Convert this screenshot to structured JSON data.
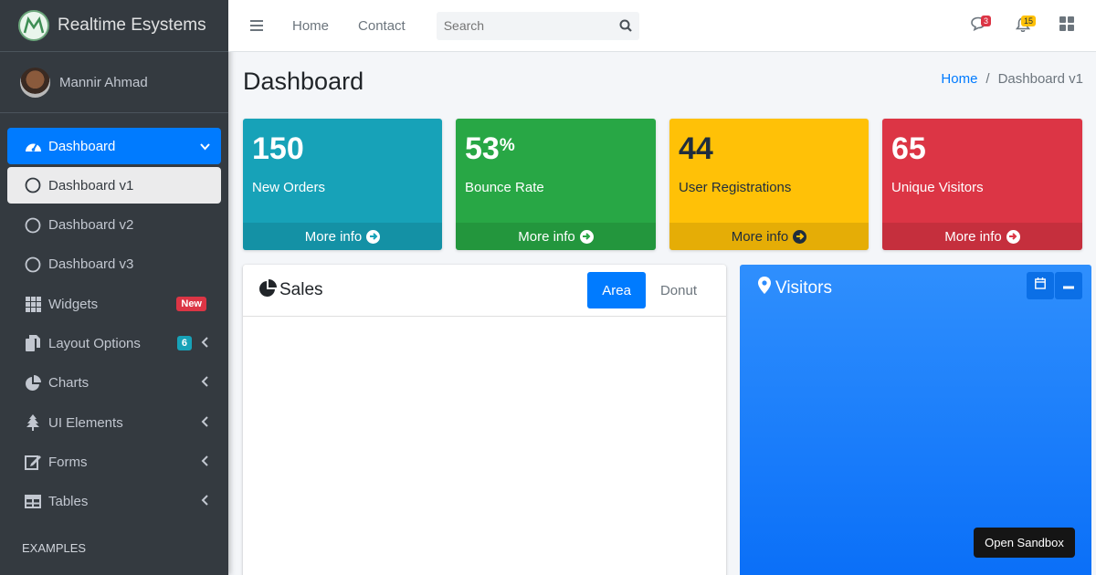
{
  "brand": {
    "name": "Realtime Esystems"
  },
  "user": {
    "name": "Mannir Ahmad"
  },
  "sidebar": {
    "items": [
      {
        "label": "Dashboard",
        "icon": "tachometer-icon"
      },
      {
        "label": "Dashboard v1",
        "icon": "circle-icon"
      },
      {
        "label": "Dashboard v2",
        "icon": "circle-icon"
      },
      {
        "label": "Dashboard v3",
        "icon": "circle-icon"
      },
      {
        "label": "Widgets",
        "icon": "th-icon",
        "badge": "New"
      },
      {
        "label": "Layout Options",
        "icon": "copy-icon",
        "badge": "6"
      },
      {
        "label": "Charts",
        "icon": "pie-chart-icon"
      },
      {
        "label": "UI Elements",
        "icon": "tree-icon"
      },
      {
        "label": "Forms",
        "icon": "edit-icon"
      },
      {
        "label": "Tables",
        "icon": "table-icon"
      }
    ],
    "header": "EXAMPLES"
  },
  "topbar": {
    "links": [
      "Home",
      "Contact"
    ],
    "search_placeholder": "Search",
    "messages_count": "3",
    "notifications_count": "15"
  },
  "content": {
    "title": "Dashboard",
    "breadcrumb": [
      "Home",
      "Dashboard v1"
    ]
  },
  "stats": [
    {
      "value": "150",
      "suffix": "",
      "label": "New Orders",
      "footer": "More info",
      "color": "#17a2b8"
    },
    {
      "value": "53",
      "suffix": "%",
      "label": "Bounce Rate",
      "footer": "More info",
      "color": "#28a745"
    },
    {
      "value": "44",
      "suffix": "",
      "label": "User Registrations",
      "footer": "More info",
      "color": "#ffc107"
    },
    {
      "value": "65",
      "suffix": "",
      "label": "Unique Visitors",
      "footer": "More info",
      "color": "#dc3545"
    }
  ],
  "sales_card": {
    "title": "Sales",
    "tabs": [
      "Area",
      "Donut"
    ]
  },
  "visitors_card": {
    "title": "Visitors"
  },
  "sandbox_button": "Open Sandbox",
  "colors": {
    "primary": "#007bff",
    "sidebar": "#343a40"
  }
}
